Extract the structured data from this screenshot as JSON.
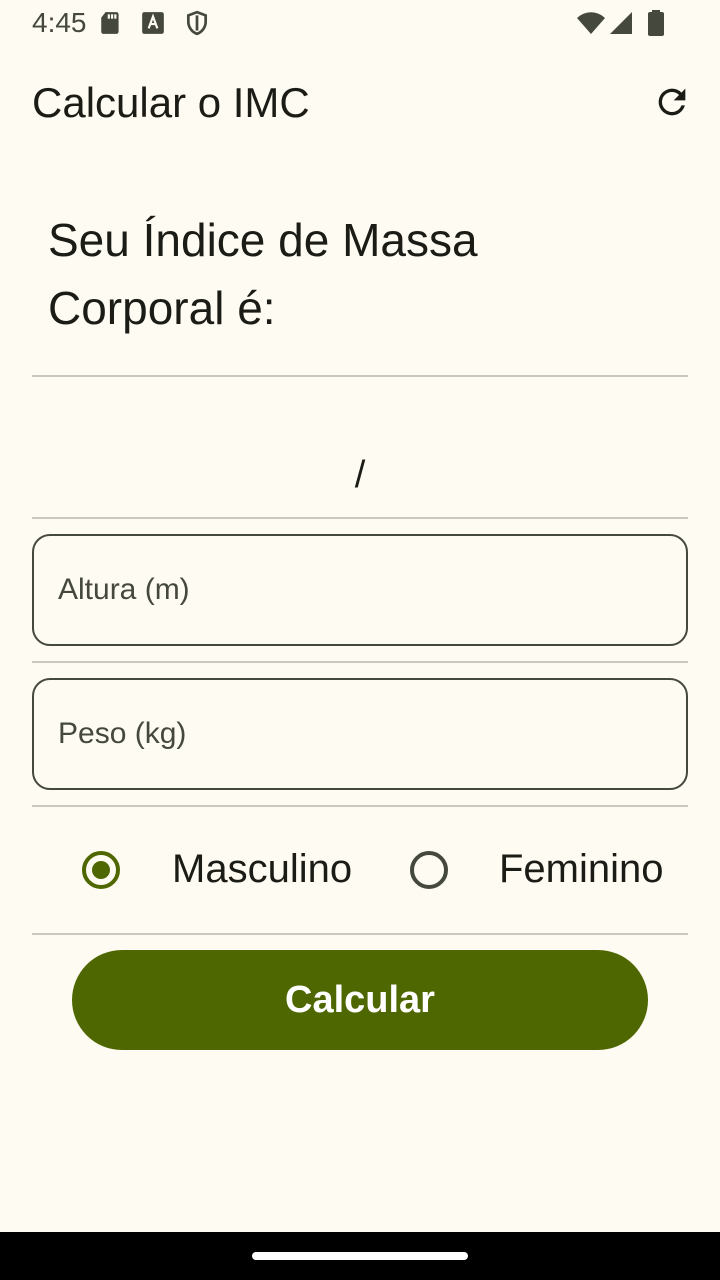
{
  "status_bar": {
    "time": "4:45",
    "icons": [
      "sd-card-icon",
      "a-font-icon",
      "shield-icon",
      "wifi-icon",
      "signal-icon",
      "battery-icon"
    ]
  },
  "app_bar": {
    "title": "Calcular o IMC",
    "action_icon": "refresh-icon"
  },
  "result": {
    "title": "Seu Índice de Massa Corporal é:",
    "value": "/"
  },
  "form": {
    "height_placeholder": "Altura (m)",
    "weight_placeholder": "Peso (kg)",
    "gender_options": [
      {
        "label": "Masculino",
        "selected": true
      },
      {
        "label": "Feminino",
        "selected": false
      }
    ],
    "submit_label": "Calcular"
  },
  "colors": {
    "background": "#FEFBF2",
    "primary": "#4F6700",
    "outline": "#44483D",
    "divider": "#C9C8BE",
    "on_surface": "#1C1C17"
  }
}
